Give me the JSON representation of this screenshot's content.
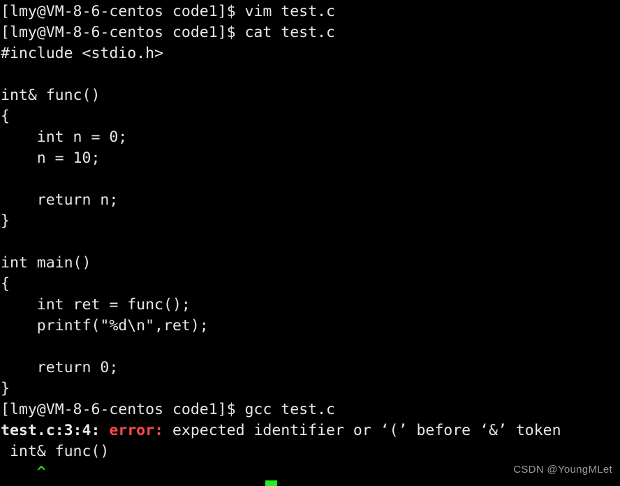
{
  "terminal": {
    "title": "lmy@VM-8-6-centos terminal",
    "colors": {
      "background": "#000000",
      "foreground": "#e8e8e8",
      "error_red": "#ff4a4a",
      "caret_green": "#1fd11f",
      "cursor_green": "#22ee22",
      "watermark_gray": "#9a9a9a"
    },
    "prompt": "[lmy@VM-8-6-centos code1]$ ",
    "commands": [
      "vim test.c",
      "cat test.c",
      "gcc test.c"
    ],
    "lines": [
      {
        "id": "line-prompt-vim",
        "parts": [
          {
            "text": "[lmy@VM-8-6-centos code1]$ vim test.c",
            "style": "normal"
          }
        ]
      },
      {
        "id": "line-prompt-cat",
        "parts": [
          {
            "text": "[lmy@VM-8-6-centos code1]$ cat test.c",
            "style": "normal"
          }
        ]
      },
      {
        "id": "line-include",
        "parts": [
          {
            "text": "#include <stdio.h>",
            "style": "normal"
          }
        ]
      },
      {
        "id": "line-blank-1",
        "parts": [
          {
            "text": "",
            "style": "normal"
          }
        ]
      },
      {
        "id": "line-func-signature",
        "parts": [
          {
            "text": "int& func()",
            "style": "normal"
          }
        ]
      },
      {
        "id": "line-func-open-brace",
        "parts": [
          {
            "text": "{",
            "style": "normal"
          }
        ]
      },
      {
        "id": "line-func-decl-n",
        "parts": [
          {
            "text": "    int n = 0;",
            "style": "normal"
          }
        ]
      },
      {
        "id": "line-func-assign-n",
        "parts": [
          {
            "text": "    n = 10;",
            "style": "normal"
          }
        ]
      },
      {
        "id": "line-blank-2",
        "parts": [
          {
            "text": "",
            "style": "normal"
          }
        ]
      },
      {
        "id": "line-func-return-n",
        "parts": [
          {
            "text": "    return n;",
            "style": "normal"
          }
        ]
      },
      {
        "id": "line-func-close-brace",
        "parts": [
          {
            "text": "}",
            "style": "normal"
          }
        ]
      },
      {
        "id": "line-blank-3",
        "parts": [
          {
            "text": "",
            "style": "normal"
          }
        ]
      },
      {
        "id": "line-main-signature",
        "parts": [
          {
            "text": "int main()",
            "style": "normal"
          }
        ]
      },
      {
        "id": "line-main-open-brace",
        "parts": [
          {
            "text": "{",
            "style": "normal"
          }
        ]
      },
      {
        "id": "line-main-decl-ret",
        "parts": [
          {
            "text": "    int ret = func();",
            "style": "normal"
          }
        ]
      },
      {
        "id": "line-main-printf",
        "parts": [
          {
            "text": "    printf(\"%d\\n\",ret);",
            "style": "normal"
          }
        ]
      },
      {
        "id": "line-blank-4",
        "parts": [
          {
            "text": "",
            "style": "normal"
          }
        ]
      },
      {
        "id": "line-main-return-0",
        "parts": [
          {
            "text": "    return 0;",
            "style": "normal"
          }
        ]
      },
      {
        "id": "line-main-close-brace",
        "parts": [
          {
            "text": "}",
            "style": "normal"
          }
        ]
      },
      {
        "id": "line-prompt-gcc",
        "parts": [
          {
            "text": "[lmy@VM-8-6-centos code1]$ gcc test.c",
            "style": "normal"
          }
        ]
      },
      {
        "id": "line-compiler-error",
        "parts": [
          {
            "text": "test.c:3:4: ",
            "style": "bold"
          },
          {
            "text": "error:",
            "style": "error"
          },
          {
            "text": " expected identifier or ‘(’ before ‘&’ token",
            "style": "normal"
          }
        ]
      },
      {
        "id": "line-error-source",
        "parts": [
          {
            "text": " int& func()",
            "style": "normal"
          }
        ]
      },
      {
        "id": "line-error-caret",
        "parts": [
          {
            "text": "    ^",
            "style": "caret"
          }
        ]
      }
    ],
    "cursor": {
      "shape": "block",
      "color": "#22ee22"
    },
    "watermark": "CSDN @YoungMLet"
  }
}
